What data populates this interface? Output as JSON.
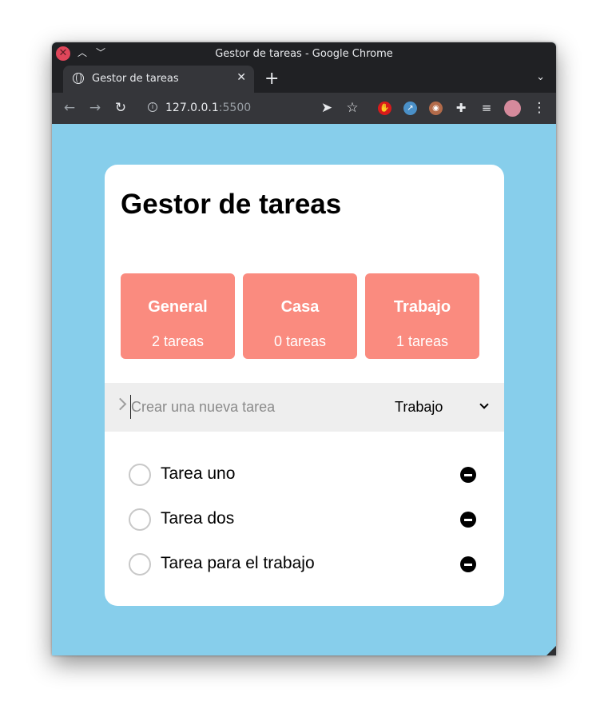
{
  "browser": {
    "window_title": "Gestor de tareas - Google Chrome",
    "tab_title": "Gestor de tareas",
    "url_host": "127.0.0.1",
    "url_port": ":5500"
  },
  "app": {
    "title": "Gestor de tareas",
    "categories": [
      {
        "name": "General",
        "count": "2 tareas"
      },
      {
        "name": "Casa",
        "count": "0 tareas"
      },
      {
        "name": "Trabajo",
        "count": "1 tareas"
      }
    ],
    "new_task": {
      "placeholder": "Crear una nueva tarea",
      "category_selected": "Trabajo"
    },
    "tasks": [
      {
        "label": "Tarea uno"
      },
      {
        "label": "Tarea dos"
      },
      {
        "label": "Tarea para el trabajo"
      }
    ]
  },
  "colors": {
    "page_background": "#87ceeb",
    "category_card": "#fa8b7f",
    "input_row": "#eeeeee"
  }
}
